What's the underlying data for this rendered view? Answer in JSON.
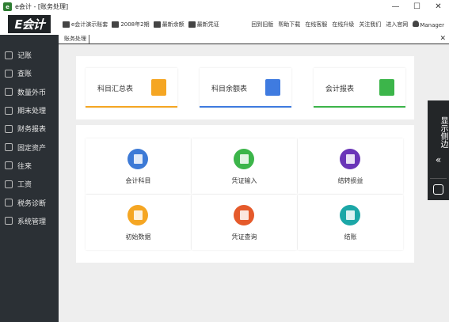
{
  "window": {
    "title": "e会计 - [账务处理]",
    "app_icon_glyph": "e",
    "controls": {
      "minimize": "—",
      "maximize": "☐",
      "close": "✕"
    }
  },
  "toolbar": {
    "logo": "E会计",
    "company": "e会计演示账套",
    "period": "2008年2期",
    "latest_balance": "最新余额",
    "latest_voucher": "最新凭证",
    "links": [
      "回到旧版",
      "帮助下载",
      "在线客服",
      "在线升级",
      "关注我们",
      "进入官网"
    ],
    "user": "Manager"
  },
  "sidebar": {
    "items": [
      {
        "label": "记账",
        "icon": "edit-icon"
      },
      {
        "label": "查账",
        "icon": "search-icon"
      },
      {
        "label": "数量外币",
        "icon": "currency-icon"
      },
      {
        "label": "期末处理",
        "icon": "calendar-icon"
      },
      {
        "label": "财务报表",
        "icon": "folder-icon"
      },
      {
        "label": "固定资产",
        "icon": "asset-icon"
      },
      {
        "label": "往来",
        "icon": "exchange-icon"
      },
      {
        "label": "工资",
        "icon": "salary-icon"
      },
      {
        "label": "税务诊断",
        "icon": "tax-icon"
      },
      {
        "label": "系统管理",
        "icon": "gear-icon"
      }
    ]
  },
  "tabs": {
    "active": "账务处理",
    "close": "✕"
  },
  "cards": [
    {
      "label": "科目汇总表",
      "color": "#f5a623",
      "line_color": "#f5a623"
    },
    {
      "label": "科目余额表",
      "color": "#3f7be0",
      "line_color": "#3f7be0"
    },
    {
      "label": "会计报表",
      "color": "#3cb54a",
      "line_color": "#3cb54a"
    }
  ],
  "tiles": [
    {
      "label": "会计科目",
      "color": "#3d7ad6"
    },
    {
      "label": "凭证输入",
      "color": "#3cb54a"
    },
    {
      "label": "结转损益",
      "color": "#6a35b8"
    },
    {
      "label": "初始数据",
      "color": "#f5a623"
    },
    {
      "label": "凭证查询",
      "color": "#e55a2b"
    },
    {
      "label": "结账",
      "color": "#1ca7a7"
    }
  ],
  "float_panel": {
    "text": "显示侧边",
    "chevron": "«"
  }
}
